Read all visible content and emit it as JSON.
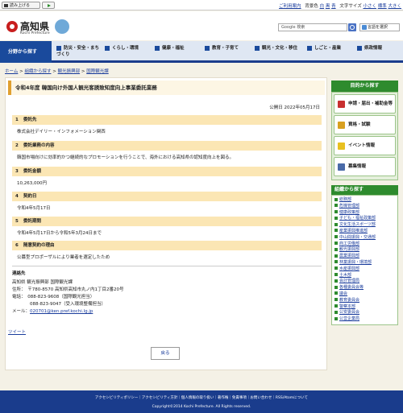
{
  "util": {
    "read_label": "読み上げる",
    "links": [
      "ご利用案内",
      "背景色",
      "白",
      "黒",
      "青",
      "文字サイズ",
      "小さく",
      "標準",
      "大きく"
    ]
  },
  "header": {
    "logo": "高知県",
    "logo_sub": "Kochi Prefecture",
    "search_placeholder": "Google 検索",
    "lang_label": "言語を選択"
  },
  "nav": {
    "first": "分野から探す",
    "items": [
      "防災・安全・まちづくり",
      "くらし・環境",
      "健康・福祉",
      "教育・子育て",
      "観光・文化・移住",
      "しごと・産業",
      "県政情報"
    ]
  },
  "breadcrumb": [
    "ホーム",
    "組織から探す",
    "観光振興部",
    "国際観光課"
  ],
  "page": {
    "title": "令和4年度 韓国向け外国人観光客誘致知度向上事業委託業務",
    "published": "公開日 2022年05月17日",
    "sections": [
      {
        "num": "1",
        "head": "委託先",
        "text": "株式会社デイリー・インフォメーション関西"
      },
      {
        "num": "2",
        "head": "委託業務の内容",
        "text": "韓国市場向けに効率的かつ継続的なプロモーションを行うことで、海外における高知県の認知度向上を図る。"
      },
      {
        "num": "3",
        "head": "委託金額",
        "text": "10,263,000円"
      },
      {
        "num": "4",
        "head": "契約日",
        "text": "令和4年5月17日"
      },
      {
        "num": "5",
        "head": "委託期間",
        "text": "令和4年5月17日から令和5年3月24日まで"
      },
      {
        "num": "6",
        "head": "随意契約の理由",
        "text": "公募型プロポーザルにより業者を選定したため"
      }
    ],
    "contact_head": "連絡先",
    "contact_lines": [
      "高知県 観光振興部 国際観光課",
      "住所：　〒780-8570 高知県高知市丸ノ内1丁目2番20号",
      "電話：　088-823-9608（国際観光担当）",
      "　　　　088-823-9047（受入環境整備担当）"
    ],
    "mail_label": "メール：",
    "mail": "020701@ken.pref.kochi.lg.jp",
    "tweet": "ツイート",
    "back": "戻る"
  },
  "side": {
    "purpose_head": "目的から探す",
    "purpose_items": [
      "申請・届出・補助金等",
      "資格・試験",
      "イベント情報",
      "募集情報"
    ],
    "org_head": "組織から探す",
    "org_items": [
      "総務部",
      "危機管理部",
      "健康政策部",
      "子ども・福祉政策部",
      "文化生活スポーツ部",
      "産業振興推進部",
      "中山間振興・交通部",
      "商工労働部",
      "観光振興部",
      "農業振興部",
      "林業振興・環境部",
      "水産振興部",
      "土木部",
      "会計管理局",
      "各種委員会等",
      "議会",
      "教育委員会",
      "警察本部",
      "公安委員会",
      "公営企業局"
    ]
  },
  "footer": {
    "links": "アクセシビリティポリシー｜アクセシビリティ方針｜個人情報の取り扱い｜著作権｜免責事項｜お問い合わせ｜RSS/Atomについて",
    "copy": "Copyright©2014 Kochi Prefecture. All Rights reserved."
  }
}
